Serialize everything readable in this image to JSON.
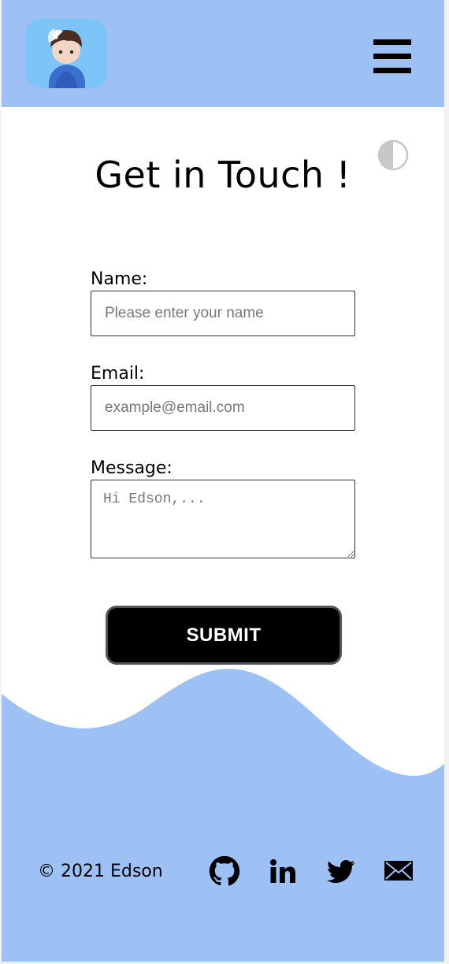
{
  "header": {
    "avatar_alt": "avatar",
    "menu_icon": "hamburger-menu-icon",
    "background": "#9ec1f5"
  },
  "theme_toggle_icon": "half-circle-contrast-icon",
  "main": {
    "title": "Get in Touch !",
    "form": {
      "name_label": "Name:",
      "name_placeholder": "Please enter your name",
      "email_label": "Email:",
      "email_placeholder": "example@email.com",
      "message_label": "Message:",
      "message_placeholder": "Hi Edson,...",
      "submit_label": "SUBMIT"
    }
  },
  "footer": {
    "copyright": "© 2021 Edson",
    "social": [
      {
        "name": "github",
        "icon": "github-icon"
      },
      {
        "name": "linkedin",
        "icon": "linkedin-icon"
      },
      {
        "name": "twitter",
        "icon": "twitter-icon"
      },
      {
        "name": "email",
        "icon": "mail-icon"
      }
    ],
    "background": "#9ec1f5"
  }
}
